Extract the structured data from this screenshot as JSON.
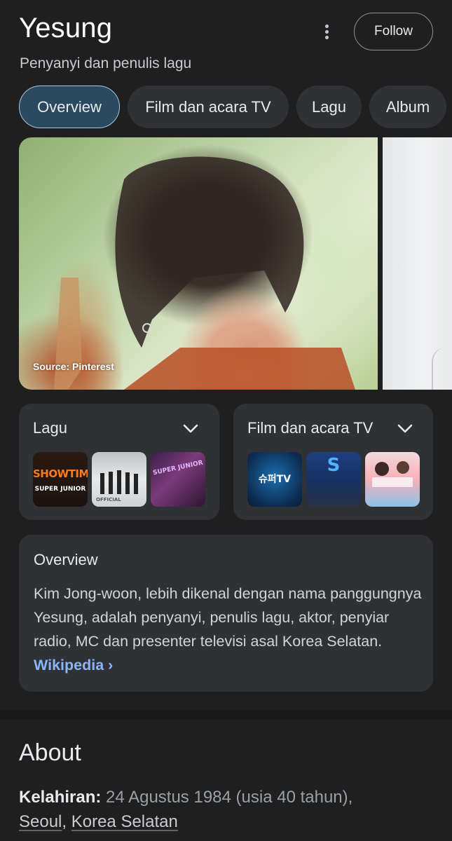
{
  "header": {
    "title": "Yesung",
    "subtitle": "Penyanyi dan penulis lagu",
    "follow_label": "Follow",
    "more_icon": "more-vert-icon"
  },
  "tabs": [
    {
      "label": "Overview",
      "active": true
    },
    {
      "label": "Film dan acara TV",
      "active": false
    },
    {
      "label": "Lagu",
      "active": false
    },
    {
      "label": "Album",
      "active": false
    }
  ],
  "images": {
    "source_label": "Source: Pinterest"
  },
  "songs_card": {
    "title": "Lagu",
    "expand_icon": "chevron-down-icon",
    "thumbs": [
      {
        "text": "SHOWTIME",
        "subtext": "SUPER JUNIOR"
      },
      {
        "text": "",
        "subtext": "OFFICIAL"
      },
      {
        "text": "SUPER JUNIOR",
        "subtext": ""
      }
    ]
  },
  "tv_card": {
    "title": "Film dan acara TV",
    "expand_icon": "chevron-down-icon",
    "thumbs": [
      {
        "text": "슈퍼TV",
        "subtext": ""
      },
      {
        "text": "S",
        "subtext": ""
      },
      {
        "text": "",
        "subtext": ""
      }
    ]
  },
  "overview": {
    "heading": "Overview",
    "text": "Kim Jong-woon, lebih dikenal dengan nama panggungnya Yesung, adalah penyanyi, penulis lagu, aktor, penyiar radio, MC dan presenter televisi asal Korea Selatan.",
    "link_label": "Wikipedia ›"
  },
  "about": {
    "title": "About",
    "birth_label": "Kelahiran:",
    "birth_value": "24 Agustus 1984 (usia 40 tahun),",
    "birth_place_city": "Seoul",
    "birth_place_separator": ", ",
    "birth_place_country": "Korea Selatan"
  },
  "colors": {
    "background": "#1f1f1f",
    "card": "#303134",
    "active_tab": "#2b4a60",
    "link": "#8ab4f8"
  }
}
